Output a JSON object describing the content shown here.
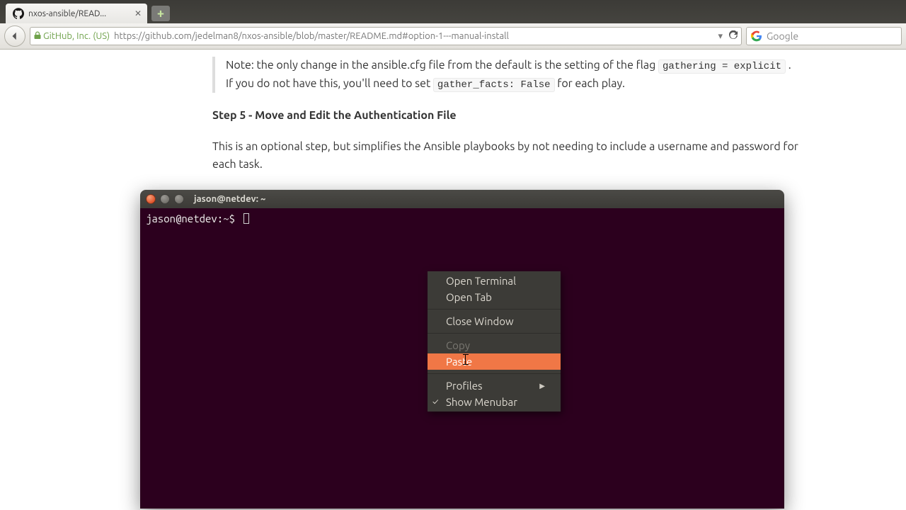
{
  "browser": {
    "tab_title": "nxos-ansible/READ...",
    "newtab_glyph": "+",
    "identity": "GitHub, Inc. (US)",
    "url": "https://github.com/jedelman8/nxos-ansible/blob/master/README.md#option-1---manual-install",
    "search_placeholder": "Google"
  },
  "readme": {
    "note_prefix": "Note: the only change in the ansible.cfg file from the default is the setting of the flag ",
    "note_code1": "gathering = explicit",
    "note_mid": " . If you do not have this, you'll need to set ",
    "note_code2": "gather_facts: False",
    "note_suffix": " for each play.",
    "step_heading": "Step 5 - Move and Edit the Authentication File",
    "step_para": "This is an optional step, but simplifies the Ansible playbooks by not needing to include a username and password for each task."
  },
  "terminal": {
    "title": "jason@netdev: ~",
    "prompt": "jason@netdev:~$"
  },
  "context_menu": {
    "open_terminal": "Open Terminal",
    "open_tab": "Open Tab",
    "close_window": "Close Window",
    "copy": "Copy",
    "paste": "Paste",
    "profiles": "Profiles",
    "show_menubar": "Show Menubar"
  }
}
